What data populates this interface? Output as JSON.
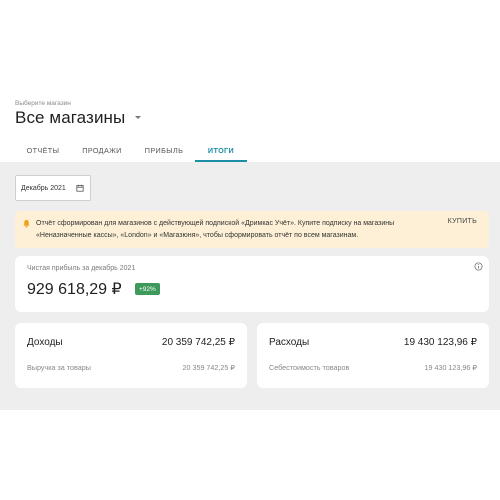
{
  "header": {
    "store_hint": "Выберите магазин",
    "store_title": "Все магазины"
  },
  "tabs": [
    {
      "label": "ОТЧЁТЫ",
      "active": false
    },
    {
      "label": "ПРОДАЖИ",
      "active": false
    },
    {
      "label": "ПРИБЫЛЬ",
      "active": false
    },
    {
      "label": "ИТОГИ",
      "active": true
    }
  ],
  "date_picker": {
    "value": "Декабрь 2021",
    "icon": "calendar-icon"
  },
  "banner": {
    "icon": "bell-icon",
    "text": "Отчёт сформирован для магазинов с действующей подпиской «Дримкас Учёт». Купите подписку на магазины «Неназначенные кассы», «London» и «Магазюня», чтобы сформировать отчёт по всем магазинам.",
    "button": "КУПИТЬ"
  },
  "profit": {
    "label": "Чистая прибыль за декабрь 2021",
    "value": "929 618,29 ₽",
    "growth": "+92%",
    "icon": "info-icon"
  },
  "income": {
    "title": "Доходы",
    "total": "20 359 742,25 ₽",
    "row_label": "Выручка за товары",
    "row_value": "20 359 742,25 ₽"
  },
  "expense": {
    "title": "Расходы",
    "total": "19 430 123,96 ₽",
    "row_label": "Себестоимость товаров",
    "row_value": "19 430 123,96 ₽"
  },
  "colors": {
    "accent": "#1b8fa3",
    "banner_bg": "#fdf0d6",
    "badge_green": "#3e9a5a",
    "bell_orange": "#f0a21b",
    "content_bg": "#eeeeee"
  }
}
